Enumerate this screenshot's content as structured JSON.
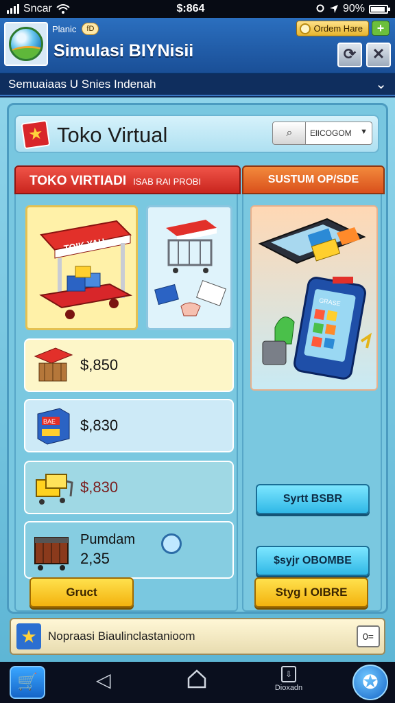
{
  "status_bar": {
    "carrier": "Sncar",
    "time": "$:864",
    "battery": "90%",
    "battery_level": 0.9
  },
  "header": {
    "small_label": "Planic",
    "small_pill": "fD",
    "title": "Simulasi BIYNisii",
    "badge_text": "Ordem Hare",
    "plus_label": "+",
    "refresh_icon": "⟳",
    "close_icon": "✕"
  },
  "subtitle": {
    "text": "Semuaiaas U Snies Indenah",
    "chevron": "⌄"
  },
  "toko": {
    "title": "Toko Virtual",
    "search_icon": "⌕",
    "dropdown_value": "ElICOGOM",
    "dropdown_arrow": "▼"
  },
  "left_panel": {
    "tab_title": "TOKO VIRTIADI",
    "tab_subtitle": "ISAB RAI PROBI",
    "stand_sign": "TOIK YAH",
    "items": [
      {
        "price": "$,850"
      },
      {
        "price": "$,830",
        "box_label": "BAE"
      },
      {
        "price": "$,830"
      },
      {
        "name": "Pumdam",
        "value": "2,35"
      }
    ],
    "bottom_button": "Gruct"
  },
  "right_panel": {
    "tab_title": "SUSTUM OP/SDE",
    "phone_label": "GRASE",
    "button1": "Syrtt BSBR",
    "button2": "$syjr OBOMBE",
    "bottom_button": "Styg I OIBRE"
  },
  "notification": {
    "text": "Nopraasi Biaulinclastanioom",
    "button": "0="
  },
  "navbar": {
    "cart_icon": "🛒",
    "back_icon": "◁",
    "ext_label": "Dioxadn",
    "star_icon": "✪"
  }
}
